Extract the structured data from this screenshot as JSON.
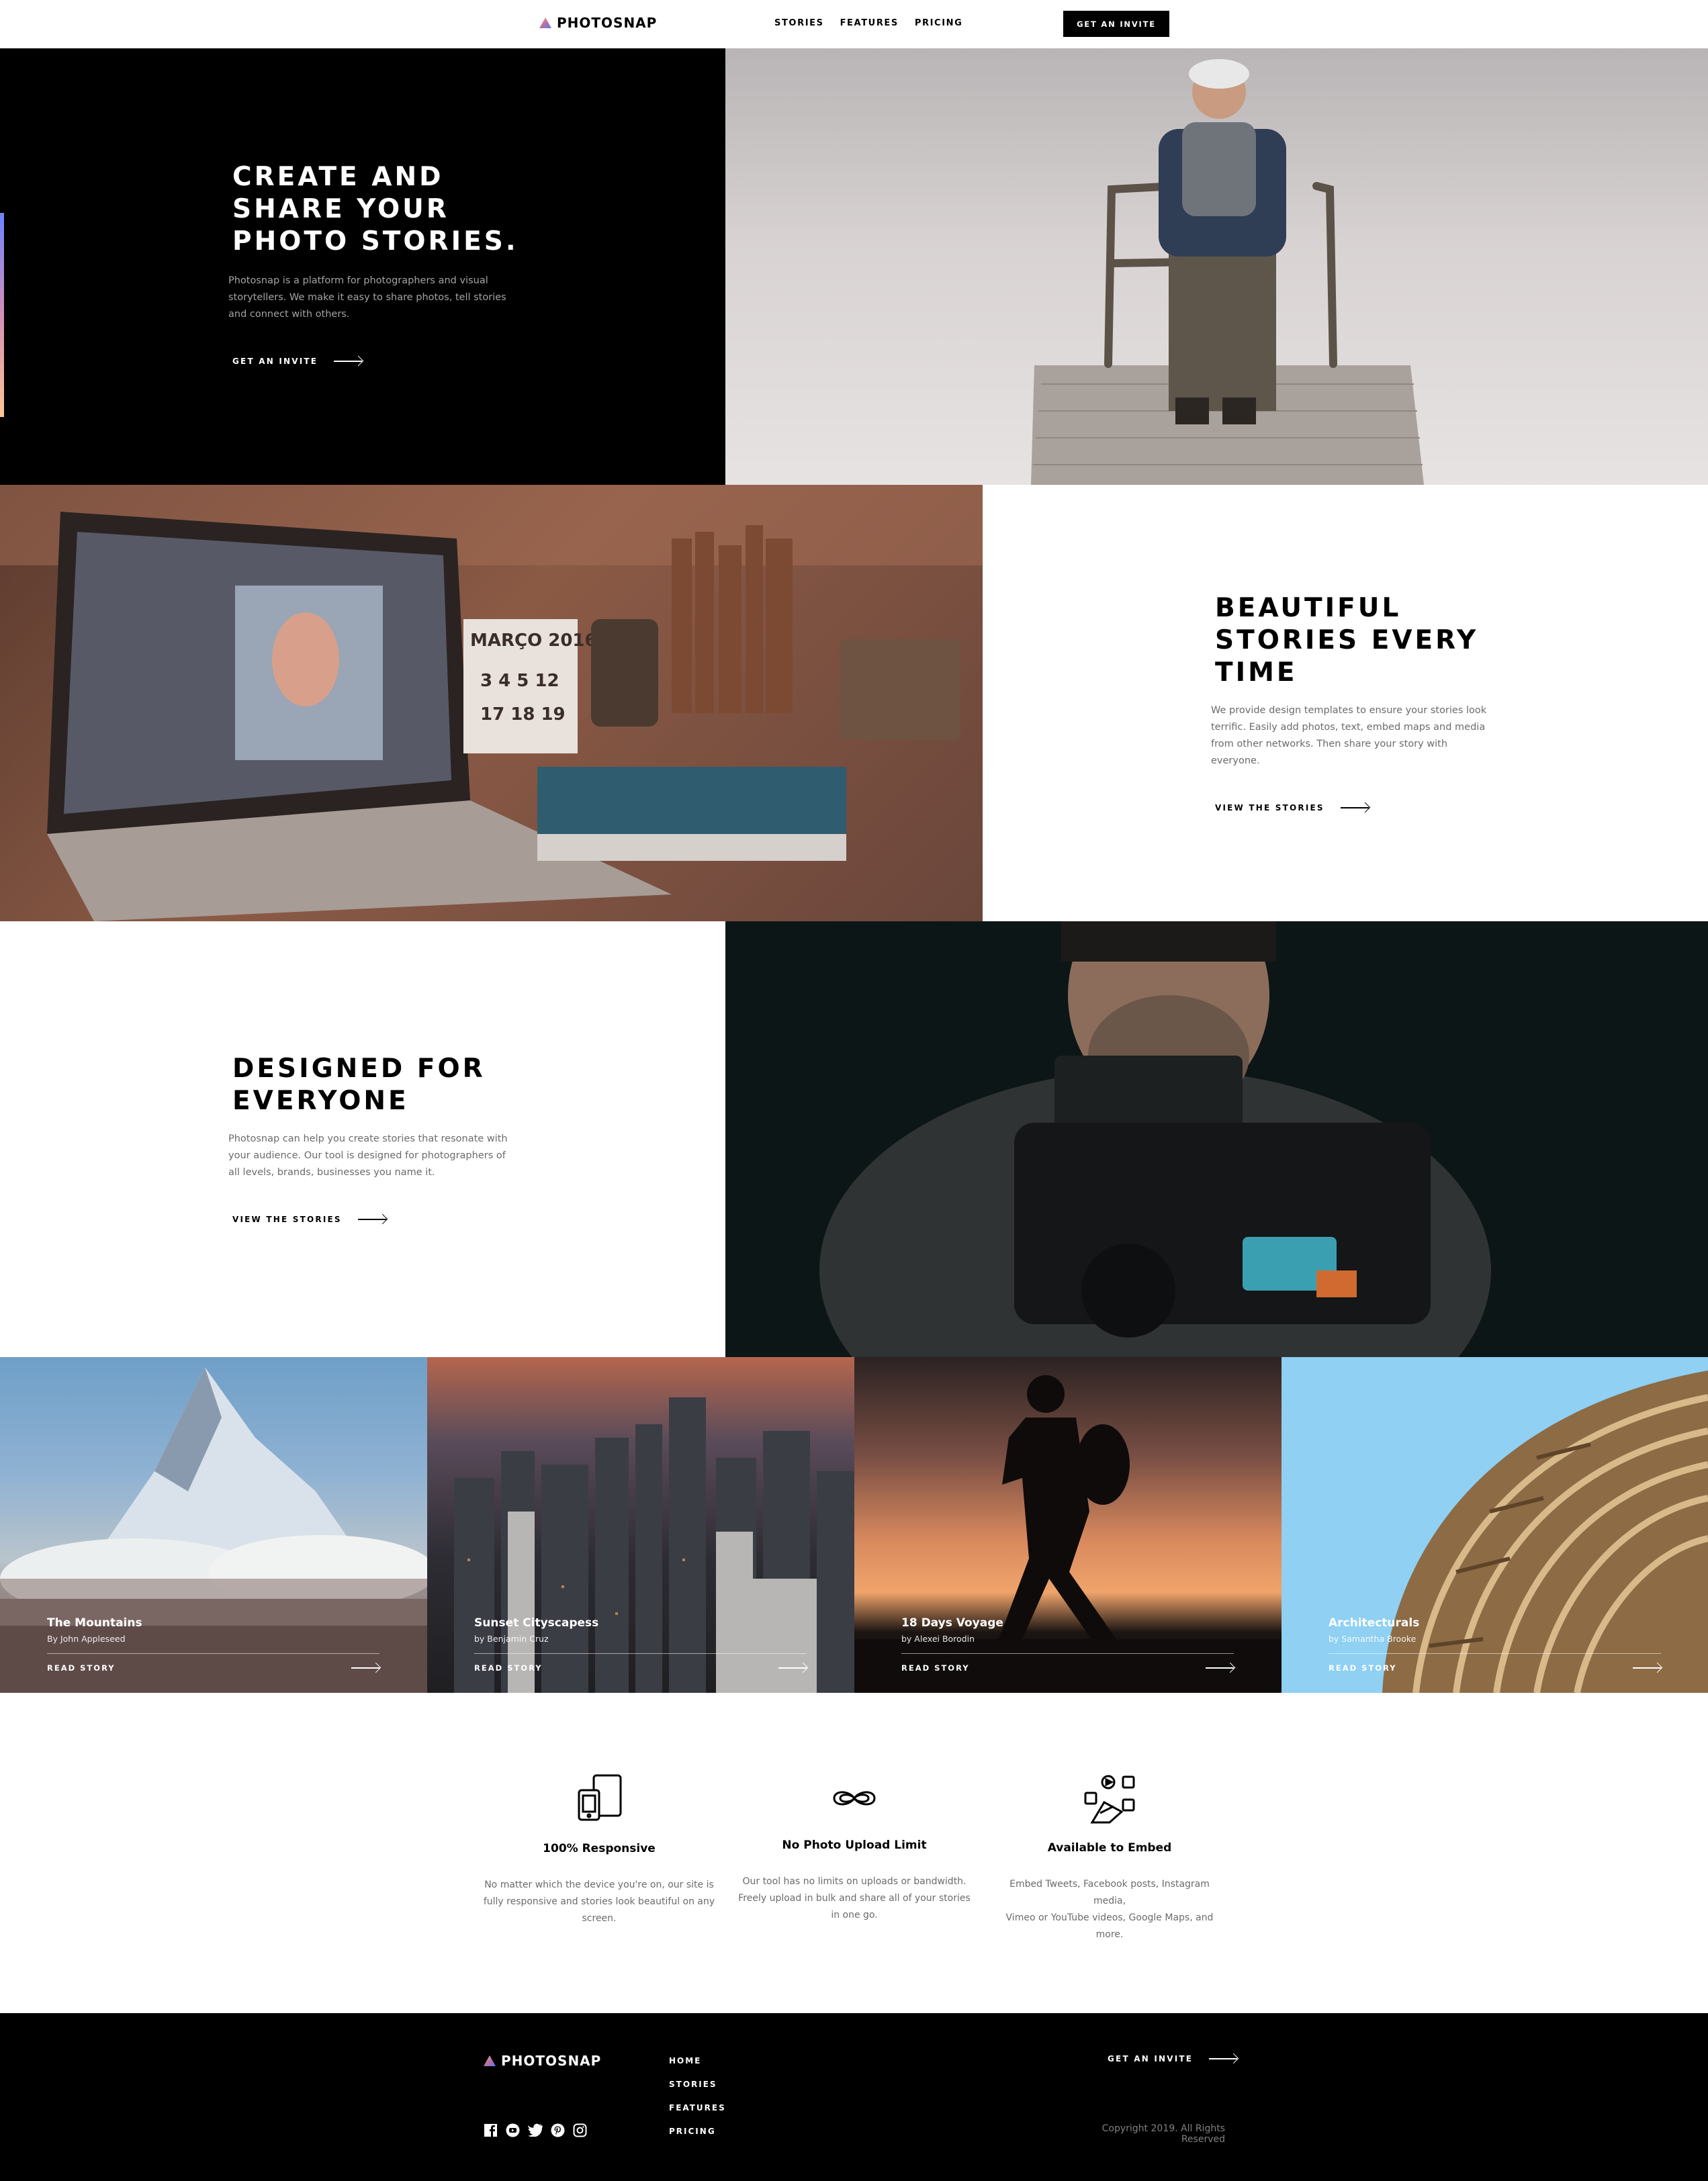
{
  "brand": {
    "name": "PHOTOSNAP"
  },
  "nav": {
    "links": [
      "STORIES",
      "FEATURES",
      "PRICING"
    ],
    "cta": "GET AN INVITE"
  },
  "hero": {
    "title": [
      "CREATE AND",
      "SHARE YOUR",
      "PHOTO STORIES."
    ],
    "body": [
      "Photosnap is a platform for photographers and visual",
      "storytellers. We make it easy to share photos, tell stories",
      "and connect with others."
    ],
    "cta": "GET AN INVITE"
  },
  "beautiful": {
    "title": [
      "BEAUTIFUL",
      "STORIES EVERY",
      "TIME"
    ],
    "body": [
      "We provide design templates to ensure your stories look",
      "terrific. Easily add photos, text, embed maps and media",
      "from other networks. Then share your story with",
      "everyone."
    ],
    "cta": "VIEW THE STORIES"
  },
  "designed": {
    "title": [
      "DESIGNED FOR",
      "EVERYONE"
    ],
    "body": [
      "Photosnap can help you create stories that resonate with",
      "your audience. Our tool is designed for photographers of",
      "all levels, brands, businesses you name it."
    ],
    "cta": "VIEW THE STORIES"
  },
  "stories": [
    {
      "title": "The Mountains",
      "author": "By John Appleseed",
      "cta": "READ STORY"
    },
    {
      "title": "Sunset Cityscapess",
      "author": "by Benjamin Cruz",
      "cta": "READ STORY"
    },
    {
      "title": "18 Days Voyage",
      "author": "by Alexei Borodin",
      "cta": "READ STORY"
    },
    {
      "title": "Architecturals",
      "author": "by Samantha Brooke",
      "cta": "READ STORY"
    }
  ],
  "features": [
    {
      "icon": "responsive-devices-icon",
      "title": "100% Responsive",
      "body": [
        "No matter which the device you're on, our site is",
        "fully responsive and stories look beautiful on any",
        "screen."
      ]
    },
    {
      "icon": "infinity-icon",
      "title": "No Photo Upload Limit",
      "body": [
        "Our tool has no limits on uploads or bandwidth.",
        "Freely upload in bulk and share all of your stories",
        "in one go."
      ]
    },
    {
      "icon": "embed-media-icon",
      "title": "Available to Embed",
      "body": [
        "Embed Tweets, Facebook posts, Instagram media,",
        "Vimeo or YouTube videos, Google Maps, and more."
      ]
    }
  ],
  "footer": {
    "links": [
      "HOME",
      "STORIES",
      "FEATURES",
      "PRICING"
    ],
    "cta": "GET AN INVITE",
    "copyright": "Copyright 2019. All Rights Reserved",
    "social": [
      "facebook-icon",
      "youtube-icon",
      "twitter-icon",
      "pinterest-icon",
      "instagram-icon"
    ]
  },
  "colors": {
    "accent_gradient": [
      "#FFC593",
      "#BC7198",
      "#5A77FF"
    ],
    "black": "#000000",
    "grey_text": "#6b6b6b"
  }
}
